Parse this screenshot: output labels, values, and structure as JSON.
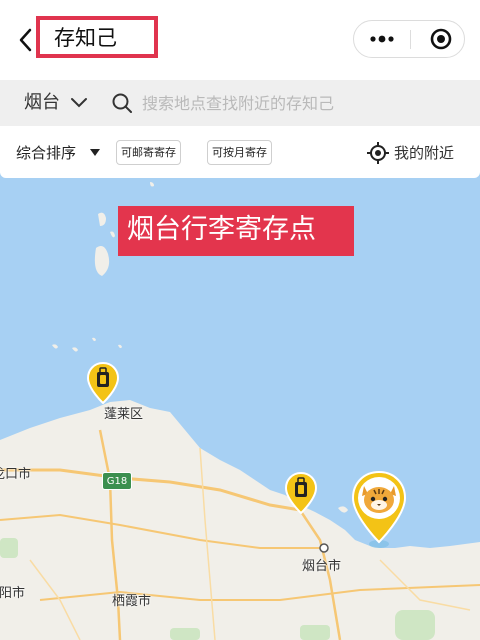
{
  "header": {
    "title": "存知己",
    "back_icon": "chevron-left-icon",
    "more_icon": "more-dots-icon",
    "close_icon": "target-circle-icon"
  },
  "search": {
    "city": "烟台",
    "placeholder": "搜索地点查找附近的存知己",
    "value": ""
  },
  "filters": {
    "sort_label": "综合排序",
    "chips": [
      "可邮寄寄存",
      "可按月寄存"
    ],
    "nearby_label": "我的附近"
  },
  "banner": {
    "text": "烟台行李寄存点"
  },
  "map": {
    "labels": {
      "penglai": "蓬莱区",
      "longkou": "龙口市",
      "yantai": "烟台市",
      "qixia": "栖霞市",
      "laiyang": "莱阳市",
      "highway": "G18"
    },
    "pins": [
      {
        "name": "luggage-pin",
        "icon": "luggage-icon"
      },
      {
        "name": "luggage-pin",
        "icon": "luggage-icon"
      },
      {
        "name": "mascot-pin",
        "icon": "tiger-mascot-icon"
      }
    ]
  },
  "colors": {
    "accent": "#e3354d",
    "pin_yellow": "#f3c316",
    "sea": "#a7d0f3",
    "land": "#f1efe9",
    "road": "#f6c774"
  }
}
